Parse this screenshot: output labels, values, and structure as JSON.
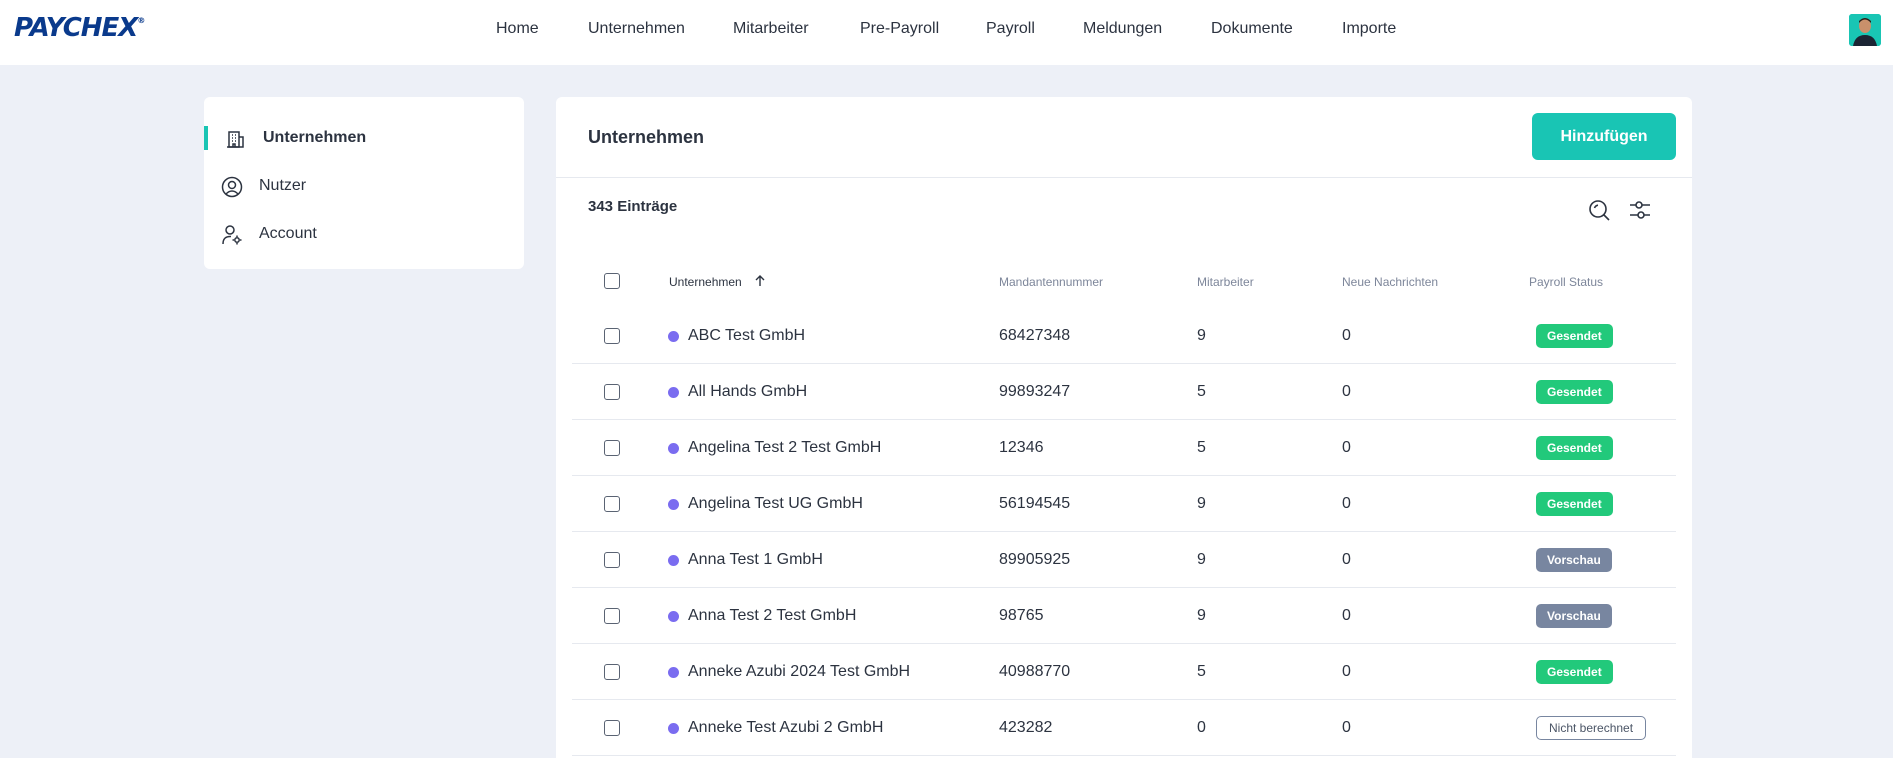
{
  "brand": {
    "logo_text": "PAYCHEX",
    "trademark": "®"
  },
  "nav": {
    "items": [
      {
        "label": "Home"
      },
      {
        "label": "Unternehmen"
      },
      {
        "label": "Mitarbeiter"
      },
      {
        "label": "Pre-Payroll"
      },
      {
        "label": "Payroll"
      },
      {
        "label": "Meldungen"
      },
      {
        "label": "Dokumente"
      },
      {
        "label": "Importe"
      }
    ]
  },
  "sidebar": {
    "items": [
      {
        "label": "Unternehmen",
        "icon": "building-icon",
        "active": true
      },
      {
        "label": "Nutzer",
        "icon": "user-circle-icon",
        "active": false
      },
      {
        "label": "Account",
        "icon": "user-settings-icon",
        "active": false
      }
    ]
  },
  "main": {
    "title": "Unternehmen",
    "add_label": "Hinzufügen",
    "count_label": "343 Einträge",
    "columns": {
      "company": "Unternehmen",
      "client_number": "Mandantennummer",
      "employees": "Mitarbeiter",
      "messages": "Neue Nachrichten",
      "status": "Payroll Status"
    },
    "rows": [
      {
        "name": "ABC Test GmbH",
        "client_number": "68427348",
        "employees": "9",
        "messages": "0",
        "status": "Gesendet",
        "status_style": "green"
      },
      {
        "name": "All Hands GmbH",
        "client_number": "99893247",
        "employees": "5",
        "messages": "0",
        "status": "Gesendet",
        "status_style": "green"
      },
      {
        "name": "Angelina Test 2 Test GmbH",
        "client_number": "12346",
        "employees": "5",
        "messages": "0",
        "status": "Gesendet",
        "status_style": "green"
      },
      {
        "name": "Angelina Test UG GmbH",
        "client_number": "56194545",
        "employees": "9",
        "messages": "0",
        "status": "Gesendet",
        "status_style": "green"
      },
      {
        "name": "Anna Test 1 GmbH",
        "client_number": "89905925",
        "employees": "9",
        "messages": "0",
        "status": "Vorschau",
        "status_style": "grey"
      },
      {
        "name": "Anna Test 2 Test GmbH",
        "client_number": "98765",
        "employees": "9",
        "messages": "0",
        "status": "Vorschau",
        "status_style": "grey"
      },
      {
        "name": "Anneke Azubi 2024 Test GmbH",
        "client_number": "40988770",
        "employees": "5",
        "messages": "0",
        "status": "Gesendet",
        "status_style": "green"
      },
      {
        "name": "Anneke Test Azubi 2 GmbH",
        "client_number": "423282",
        "employees": "0",
        "messages": "0",
        "status": "Nicht berechnet",
        "status_style": "outline"
      }
    ]
  },
  "colors": {
    "accent": "#19c5b4",
    "brand": "#0a3a8c",
    "status_green": "#22c97b",
    "status_grey": "#7886a0",
    "dot": "#7a6cf0"
  }
}
